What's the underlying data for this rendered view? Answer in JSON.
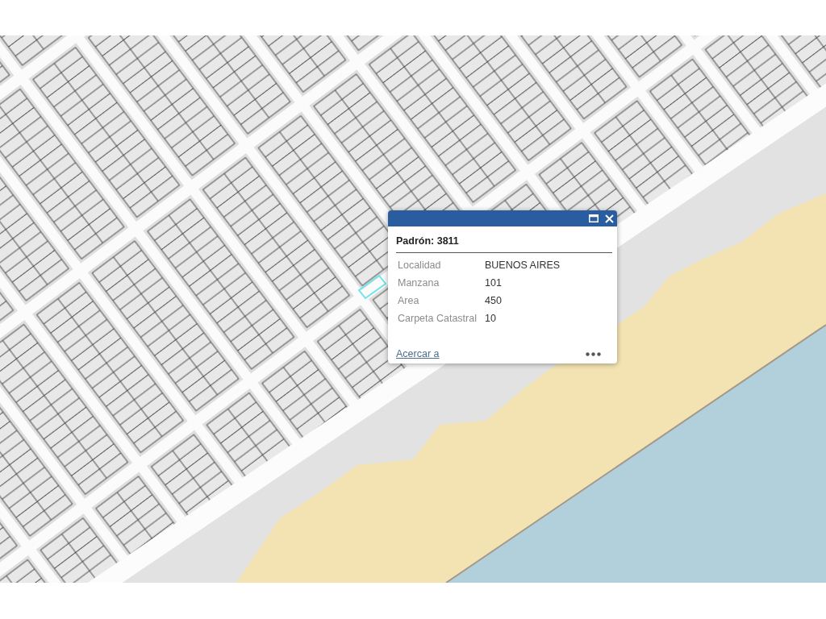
{
  "popup": {
    "heading": "Padrón: 3811",
    "fields": [
      {
        "label": "Localidad",
        "value": "BUENOS AIRES"
      },
      {
        "label": "Manzana",
        "value": "101"
      },
      {
        "label": "Area",
        "value": "450"
      },
      {
        "label": "Carpeta Catastral",
        "value": "10"
      }
    ],
    "link": "Acercar a"
  }
}
